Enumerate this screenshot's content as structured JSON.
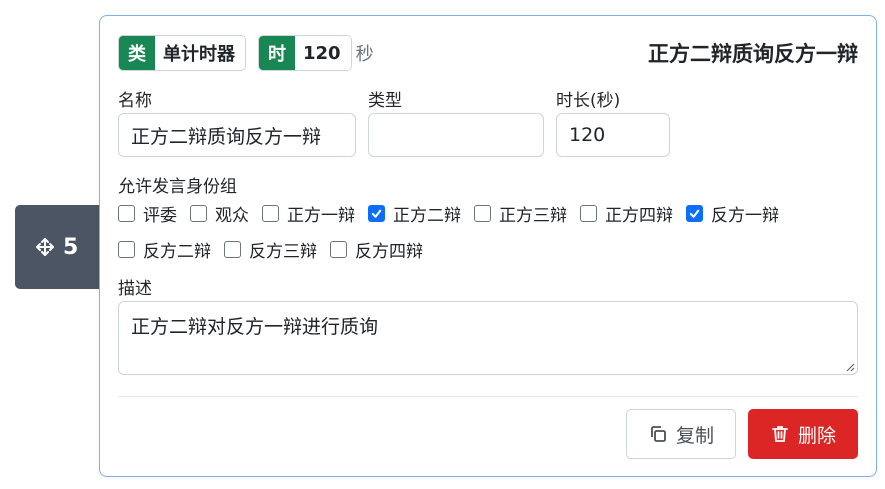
{
  "handle": {
    "number": "5"
  },
  "header": {
    "type_tag": "类",
    "type_value": "单计时器",
    "time_tag": "时",
    "time_value": "120",
    "time_unit": "秒",
    "title": "正方二辩质询反方一辩"
  },
  "form": {
    "name_label": "名称",
    "name_value": "正方二辩质询反方一辩",
    "type_label": "类型",
    "type_value": "",
    "duration_label": "时长(秒)",
    "duration_value": "120",
    "roles_label": "允许发言身份组",
    "roles": [
      {
        "label": "评委",
        "checked": false
      },
      {
        "label": "观众",
        "checked": false
      },
      {
        "label": "正方一辩",
        "checked": false
      },
      {
        "label": "正方二辩",
        "checked": true
      },
      {
        "label": "正方三辩",
        "checked": false
      },
      {
        "label": "正方四辩",
        "checked": false
      },
      {
        "label": "反方一辩",
        "checked": true
      },
      {
        "label": "反方二辩",
        "checked": false
      },
      {
        "label": "反方三辩",
        "checked": false
      },
      {
        "label": "反方四辩",
        "checked": false
      }
    ],
    "description_label": "描述",
    "description_value": "正方二辩对反方一辩进行质询"
  },
  "actions": {
    "copy_label": "复制",
    "delete_label": "删除"
  },
  "colors": {
    "tag_green": "#198754",
    "check_blue": "#0d6efd",
    "delete_red": "#dc2626",
    "card_border": "#7fb0e6",
    "handle_bg": "#4b5563"
  },
  "icons": {
    "handle": "move-arrows-icon",
    "copy": "copy-icon",
    "delete": "trash-icon"
  }
}
